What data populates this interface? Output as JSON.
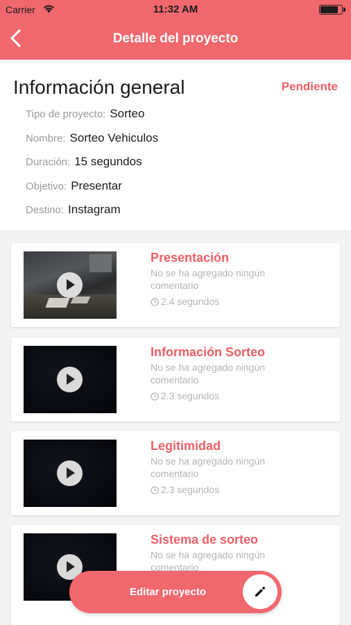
{
  "status_bar": {
    "carrier": "Carrier",
    "time": "11:32 AM",
    "battery_level": 0.85
  },
  "nav": {
    "title": "Detalle del proyecto",
    "back_icon": "chevron-left-icon"
  },
  "info": {
    "heading": "Información general",
    "status": "Pendiente",
    "fields": [
      {
        "label": "Tipo de proyecto:",
        "value": "Sorteo"
      },
      {
        "label": "Nombre:",
        "value": "Sorteo Vehiculos"
      },
      {
        "label": "Duración:",
        "value": "15 segundos"
      },
      {
        "label": "Objetivo:",
        "value": "Presentar"
      },
      {
        "label": "Destino:",
        "value": "Instagram"
      }
    ]
  },
  "clips": [
    {
      "title": "Presentación",
      "comment": "No se ha agregado ningún comentario",
      "duration": "2.4 segundos"
    },
    {
      "title": "Información Sorteo",
      "comment": "No se ha agregado ningún comentario",
      "duration": "2.3 segundos"
    },
    {
      "title": "Legitimidad",
      "comment": "No se ha agregado ningún comentario",
      "duration": "2.3 segundos"
    },
    {
      "title": "Sistema de sorteo",
      "comment": "No se ha agregado ningún comentario",
      "duration": ""
    }
  ],
  "fab": {
    "label": "Editar proyecto",
    "icon": "pencil-icon"
  },
  "colors": {
    "accent": "#f0686e",
    "title_red": "#ec5f65",
    "muted": "#b4b4b4"
  }
}
